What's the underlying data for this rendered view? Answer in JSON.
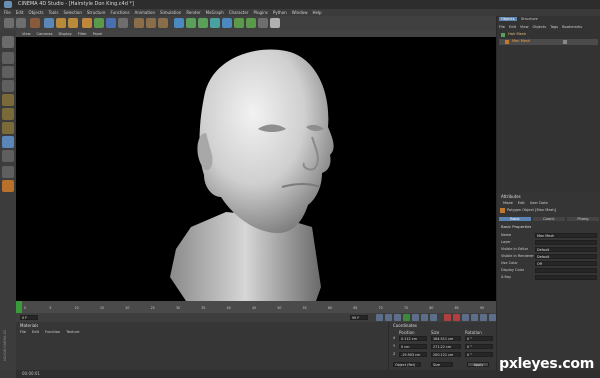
{
  "window": {
    "title": "CINEMA 4D Studio - [Hairstyle Don King.c4d *]"
  },
  "menu": [
    "File",
    "Edit",
    "Objects",
    "Tools",
    "Selection",
    "Structure",
    "Functions",
    "Animation",
    "Simulation",
    "Render",
    "MoGraph",
    "Character",
    "Plugins",
    "Python",
    "Window",
    "Help"
  ],
  "viewport": {
    "menu": [
      "View",
      "Cameras",
      "Display",
      "Filter",
      "Panel"
    ]
  },
  "timeline": {
    "ticks": [
      "0",
      "5",
      "10",
      "15",
      "20",
      "25",
      "30",
      "35",
      "40",
      "45",
      "50",
      "55",
      "60",
      "65",
      "70",
      "75",
      "80",
      "85",
      "90"
    ],
    "current_frame": "0 F",
    "end_frame": "90 F"
  },
  "material_panel": {
    "title": "Materials",
    "menu": [
      "File",
      "Edit",
      "Function",
      "Texture"
    ]
  },
  "coord_panel": {
    "title": "Coordinates",
    "headers": [
      "Position",
      "Size",
      "Rotation"
    ],
    "rows": [
      {
        "axis": "X",
        "pos": "0.112 cm",
        "size": "164.511 cm",
        "rot": "0 °"
      },
      {
        "axis": "Y",
        "pos": "0 cm",
        "size": "271.22 cm",
        "rot": "0 °"
      },
      {
        "axis": "Z",
        "pos": "-19.903 cm",
        "size": "200.121 cm",
        "rot": "0 °"
      }
    ],
    "mode": "Object (Rel)",
    "size_mode": "Size",
    "apply": "Apply"
  },
  "object_manager": {
    "tabs": [
      "Objects",
      "Structure"
    ],
    "menu": [
      "File",
      "Edit",
      "View",
      "Objects",
      "Tags",
      "Bookmarks"
    ],
    "items": [
      "Hair Mesh",
      "Man Mesh"
    ]
  },
  "attributes": {
    "title": "Attributes",
    "menu": [
      "Mode",
      "Edit",
      "User Data"
    ],
    "object_label": "Polygon Object [Man Mesh]",
    "tabs": [
      "Basic",
      "Coord.",
      "Phong"
    ],
    "section": "Basic Properties",
    "fields": [
      {
        "label": "Name",
        "value": "Man Mesh"
      },
      {
        "label": "Layer",
        "value": ""
      },
      {
        "label": "Visible in Editor",
        "value": "Default"
      },
      {
        "label": "Visible in Renderer",
        "value": "Default"
      },
      {
        "label": "Use Color",
        "value": "Off"
      },
      {
        "label": "Display Color",
        "value": ""
      },
      {
        "label": "X-Ray",
        "value": ""
      }
    ]
  },
  "statusbar": {
    "text": "00:00:01"
  },
  "side_label": "MAXON CINEMA 4D",
  "watermark": "pxleyes.com",
  "colors": {
    "accent": "#5b84b4",
    "viewport_bg": "#000000",
    "ui_bg": "#3a3a3a"
  }
}
